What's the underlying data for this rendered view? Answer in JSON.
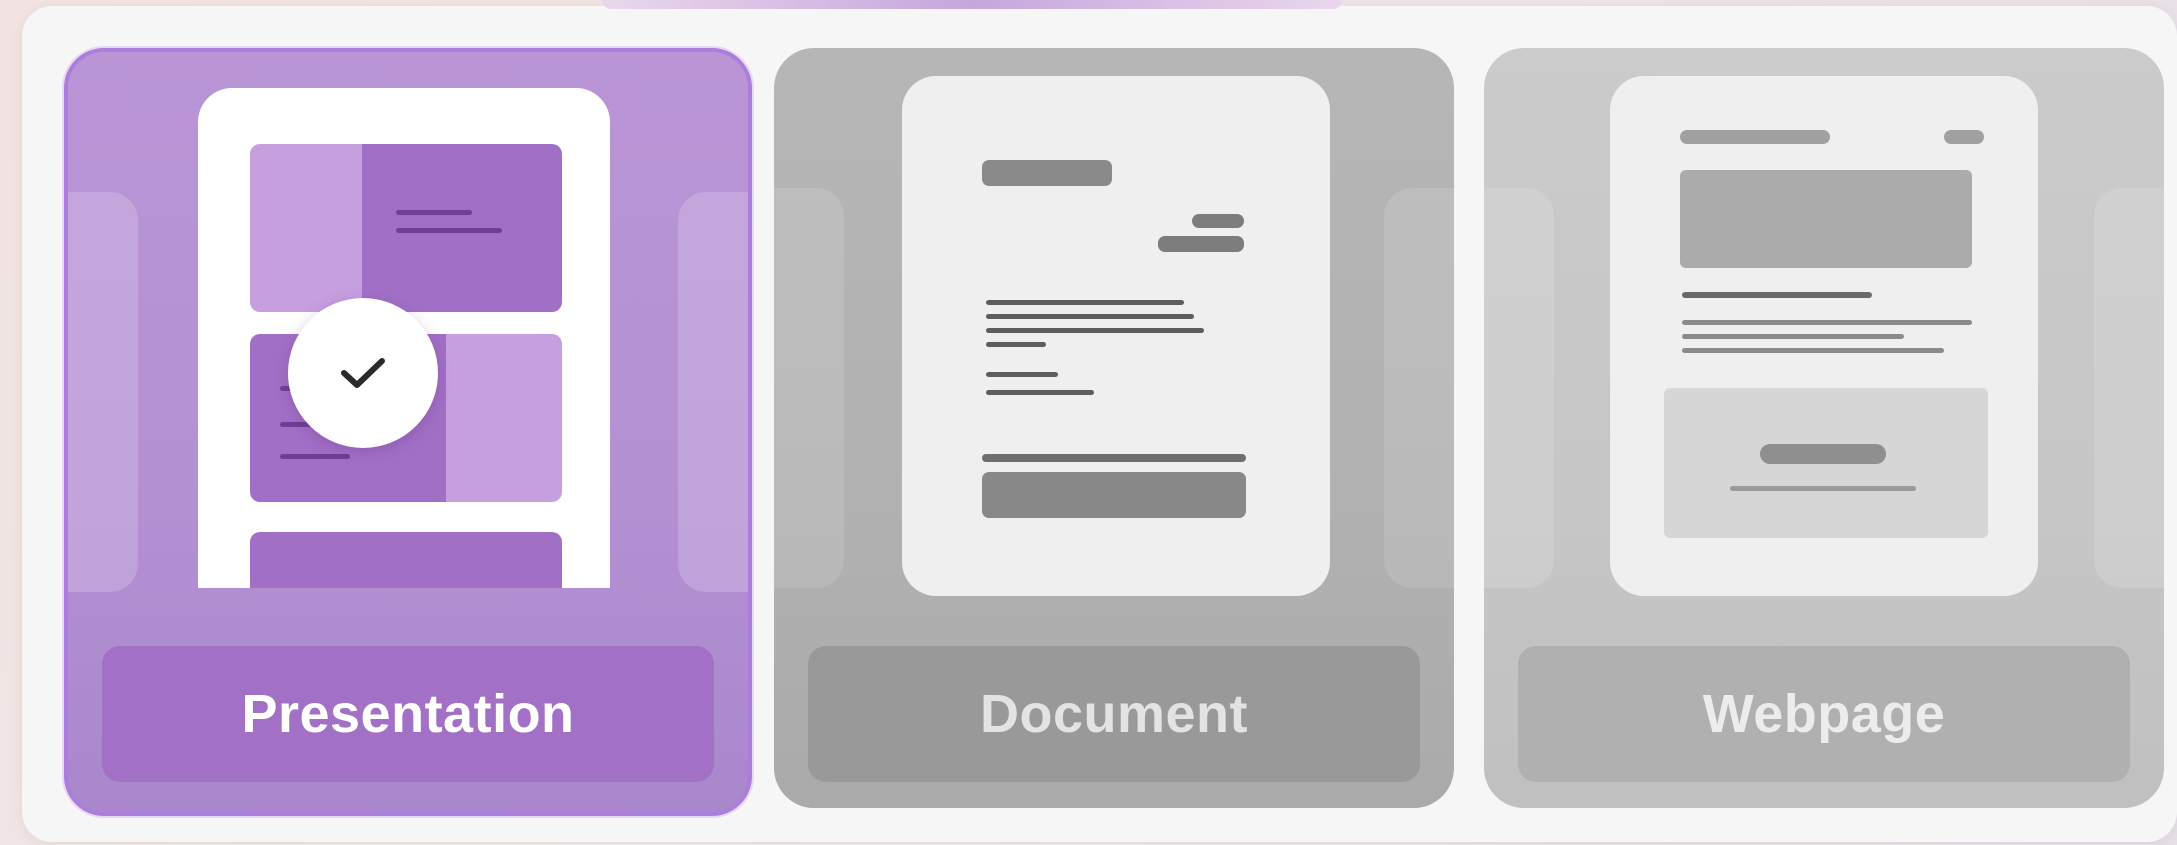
{
  "options": [
    {
      "label": "Presentation",
      "selected": true,
      "icon": "checkmark-icon"
    },
    {
      "label": "Document",
      "selected": false
    },
    {
      "label": "Webpage",
      "selected": false
    }
  ],
  "colors": {
    "selected_bg": "#b995d6",
    "selected_border": "#ab7ddc",
    "selected_label_bg": "#a271c6",
    "unselected_bg": "#b6b6b6",
    "unselected_label_bg": "#999999"
  }
}
